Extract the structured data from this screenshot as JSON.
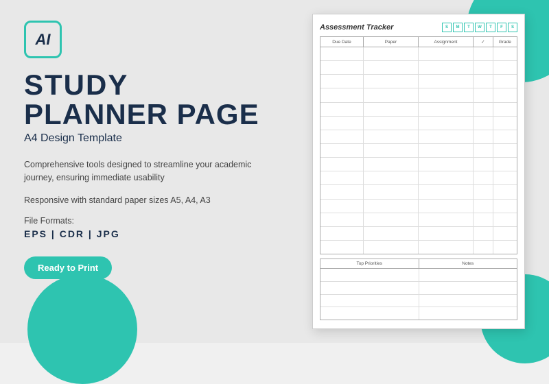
{
  "left": {
    "ai_logo": "AI",
    "study_label": "STUDY",
    "planner_label": "PLANNER PAGE",
    "subtitle": "A4 Design Template",
    "description": "Comprehensive tools designed to streamline\nyour academic journey, ensuring immediate usability",
    "responsive_text": "Responsive with standard paper sizes A5, A4, A3",
    "file_formats_label": "File Formats:",
    "file_formats_values": "EPS  |  CDR  |  JPG",
    "ready_to_print": "Ready to Print"
  },
  "document": {
    "title": "Assessment Tracker",
    "days": [
      "S",
      "M",
      "T",
      "W",
      "T",
      "F",
      "S"
    ],
    "columns": [
      "Due Date",
      "Paper",
      "Assignment",
      "✓",
      "Grade"
    ],
    "bottom_columns": [
      "Top Priorities",
      "Notes"
    ],
    "row_count": 15,
    "bottom_row_count": 4
  },
  "colors": {
    "teal": "#2ec4b0",
    "dark_navy": "#1a2e4a"
  }
}
